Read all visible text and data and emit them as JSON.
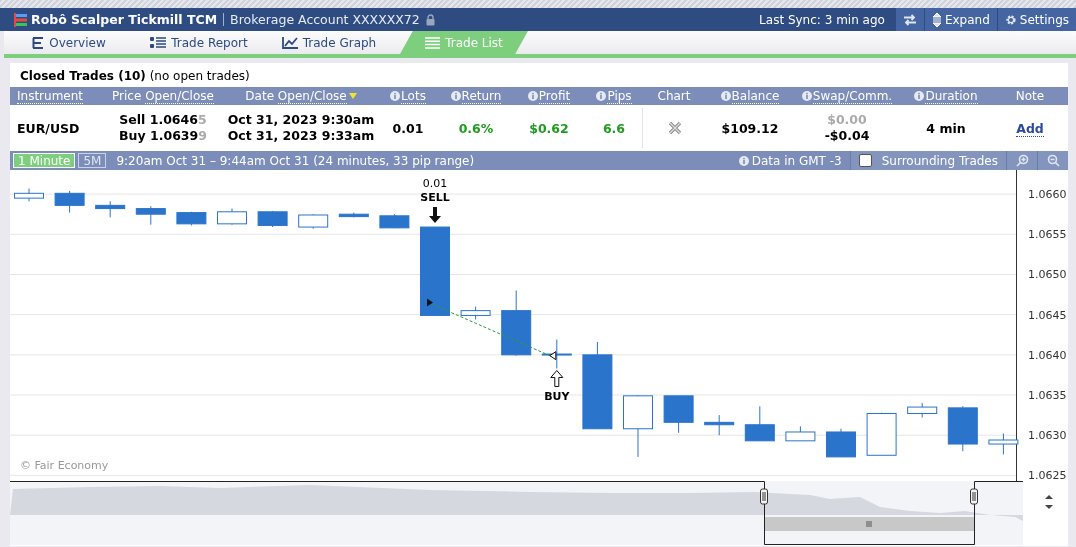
{
  "window": {
    "title": "Robô Scalper Tickmill TCM",
    "subtitle": "Brokerage Account XXXXXX72",
    "sync": "Last Sync: 3 min ago",
    "buttons": [
      {
        "kind": "sync"
      },
      {
        "kind": "expand",
        "label": "Expand"
      },
      {
        "kind": "settings",
        "label": "Settings"
      }
    ]
  },
  "tabs": [
    {
      "label": "Overview",
      "selected": false
    },
    {
      "label": "Trade Report",
      "selected": false
    },
    {
      "label": "Trade Graph",
      "selected": false
    },
    {
      "label": "Trade List",
      "selected": true
    }
  ],
  "summary": {
    "title": "Closed Trades (10)",
    "note": "(no open trades)"
  },
  "table": {
    "columns": [
      {
        "label": "Instrument",
        "info": false,
        "link": true
      },
      {
        "prefix": "Price",
        "label": "Open/Close",
        "info": false,
        "link": true
      },
      {
        "prefix": "Date",
        "label": "Open/Close",
        "info": false,
        "link": true,
        "sorted": true
      },
      {
        "label": "Lots",
        "info": true,
        "link": true
      },
      {
        "label": "Return",
        "info": true,
        "link": true
      },
      {
        "label": "Profit",
        "info": true,
        "link": true
      },
      {
        "label": "Pips",
        "info": true,
        "link": true
      },
      {
        "label": "Chart",
        "info": false,
        "link": false
      },
      {
        "label": "Balance",
        "info": true,
        "link": true
      },
      {
        "label": "Swap/Comm.",
        "info": true,
        "link": true
      },
      {
        "label": "Duration",
        "info": true,
        "link": true
      },
      {
        "label": "Note",
        "info": false,
        "link": false
      }
    ],
    "rows": [
      {
        "instrument": "EUR/USD",
        "prices": [
          {
            "text": "Sell 1.0646",
            "tail": "5"
          },
          {
            "text": "Buy 1.0639",
            "tail": "9"
          }
        ],
        "dates": [
          "Oct 31, 2023 9:30am",
          "Oct 31, 2023 9:33am"
        ],
        "lots": "0.01",
        "return": "0.6%",
        "profit": "$0.62",
        "pips": "6.6",
        "chart_open": true,
        "balance": "$109.12",
        "swap": "$0.00",
        "comm": "-$0.04",
        "duration": "4 min",
        "note": "Add"
      }
    ]
  },
  "chart_bar": {
    "intervals": [
      {
        "label": "1 Minute",
        "selected": true
      },
      {
        "label": "5M",
        "selected": false
      }
    ],
    "range": "9:20am Oct 31 – 9:44am Oct 31 (24 minutes, 33 pip range)",
    "timezone": "Data in GMT -3",
    "surrounding": {
      "label": "Surrounding Trades",
      "checked": false
    }
  },
  "chart": {
    "watermark": "© Fair Economy",
    "axis_labels": [
      "1.0660",
      "1.0655",
      "1.0650",
      "1.0645",
      "1.0640",
      "1.0635",
      "1.0630",
      "1.0625"
    ],
    "markers": [
      {
        "kind": "sell",
        "size": "0.01",
        "label": "SELL"
      },
      {
        "kind": "buy",
        "label": "BUY"
      }
    ]
  }
}
